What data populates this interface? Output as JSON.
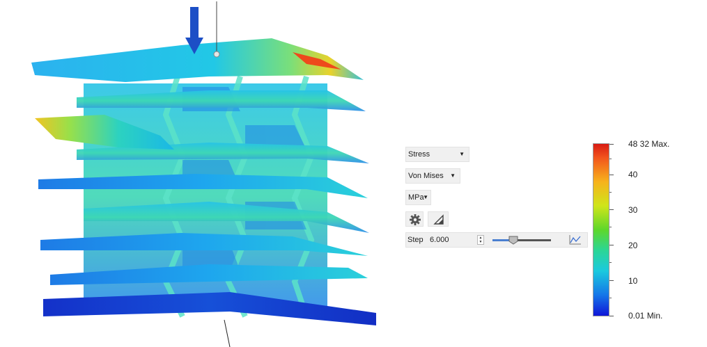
{
  "controls": {
    "result_type": {
      "selected": "Stress"
    },
    "stress_component": {
      "selected": "Von Mises"
    },
    "unit": {
      "selected": "MPa"
    },
    "settings_icon": "gear-icon",
    "deformation_icon": "triangle-icon",
    "step": {
      "label": "Step",
      "value": "6.000"
    },
    "slider": {
      "level": 0.36
    },
    "graph_icon": "graph-icon"
  },
  "legend": {
    "max_label": "48 32 Max.",
    "min_label": "0.01 Min.",
    "ticks": [
      "40",
      "30",
      "20",
      "10"
    ],
    "colors": [
      "#d81b13",
      "#f7b21c",
      "#5ed72a",
      "#1bc9de",
      "#1016d8"
    ]
  }
}
